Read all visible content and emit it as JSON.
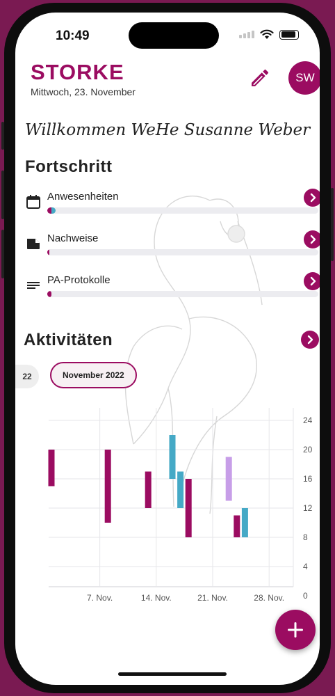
{
  "status_bar": {
    "time": "10:49"
  },
  "header": {
    "title": "STORKE",
    "date": "Mittwoch, 23. November",
    "avatar_initials": "SW"
  },
  "welcome_text": "Willkommen WeHe Susanne Weber",
  "progress": {
    "title": "Fortschritt",
    "items": [
      {
        "label": "Anwesenheiten",
        "icon": "calendar-icon",
        "value_pct": 3
      },
      {
        "label": "Nachweise",
        "icon": "document-icon",
        "value_pct": 1
      },
      {
        "label": "PA-Protokolle",
        "icon": "lines-icon",
        "value_pct": 2
      }
    ]
  },
  "activities": {
    "title": "Aktivitäten",
    "chips": [
      {
        "label": "22",
        "selected": false
      },
      {
        "label": "November 2022",
        "selected": true
      }
    ]
  },
  "colors": {
    "brand": "#9b0c61",
    "teal": "#45a9c6",
    "lavender": "#c79ee8",
    "track": "#ececf0"
  },
  "chart_data": {
    "type": "bar",
    "title": "",
    "xlabel": "",
    "ylabel": "",
    "ylim": [
      0,
      24
    ],
    "yticks": [
      0,
      4,
      8,
      12,
      16,
      20,
      24
    ],
    "xticks": [
      {
        "label": "7. Nov.",
        "day": 7
      },
      {
        "label": "14. Nov.",
        "day": 14
      },
      {
        "label": "21. Nov.",
        "day": 21
      },
      {
        "label": "28. Nov.",
        "day": 28
      }
    ],
    "bars": [
      {
        "day": 1,
        "from": 15,
        "to": 20,
        "color": "brand"
      },
      {
        "day": 8,
        "from": 10,
        "to": 20,
        "color": "brand"
      },
      {
        "day": 13,
        "from": 12,
        "to": 17,
        "color": "brand"
      },
      {
        "day": 16,
        "from": 16,
        "to": 22,
        "color": "teal"
      },
      {
        "day": 17,
        "from": 12,
        "to": 17,
        "color": "teal"
      },
      {
        "day": 18,
        "from": 8,
        "to": 16,
        "color": "brand"
      },
      {
        "day": 23,
        "from": 13,
        "to": 19,
        "color": "lavender"
      },
      {
        "day": 24,
        "from": 8,
        "to": 11,
        "color": "brand"
      },
      {
        "day": 25,
        "from": 8,
        "to": 12,
        "color": "teal"
      }
    ],
    "grid": true
  }
}
